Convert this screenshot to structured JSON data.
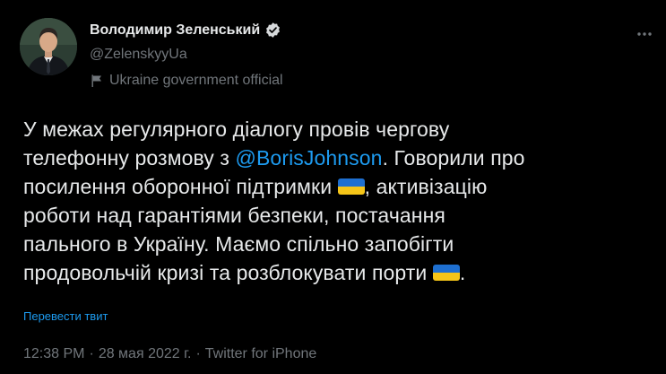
{
  "author": {
    "display_name": "Володимир Зеленський",
    "handle": "@ZelenskyyUa",
    "affiliation": "Ukraine government official"
  },
  "tweet": {
    "lines": [
      {
        "segments": [
          {
            "text": "У межах регулярного діалогу провів чергову"
          }
        ]
      },
      {
        "segments": [
          {
            "text": "телефонну розмову з "
          },
          {
            "text": "@BorisJohnson",
            "mention": true
          },
          {
            "text": ". Говорили про"
          }
        ]
      },
      {
        "segments": [
          {
            "text": "посилення оборонної підтримки "
          },
          {
            "flag": "ukraine-flag"
          },
          {
            "text": ", активізацію"
          }
        ]
      },
      {
        "segments": [
          {
            "text": "роботи над гарантіями безпеки, постачання"
          }
        ]
      },
      {
        "segments": [
          {
            "text": "пального в Україну. Маємо спільно запобігти"
          }
        ]
      },
      {
        "segments": [
          {
            "text": "продовольчій кризі та розблокувати порти "
          },
          {
            "flag": "ukraine-flag"
          },
          {
            "text": "."
          }
        ]
      }
    ],
    "translate_label": "Перевести твит"
  },
  "meta": {
    "time": "12:38 PM",
    "separator": "·",
    "date": "28 мая 2022 г.",
    "source": "Twitter for iPhone"
  },
  "colors": {
    "background": "#000000",
    "text": "#e7e9ea",
    "secondary": "#71767b",
    "link": "#1d9bf0"
  },
  "icons": {
    "verified": "verified-badge-icon",
    "affiliation": "flag-icon",
    "more": "more-dots-icon"
  }
}
